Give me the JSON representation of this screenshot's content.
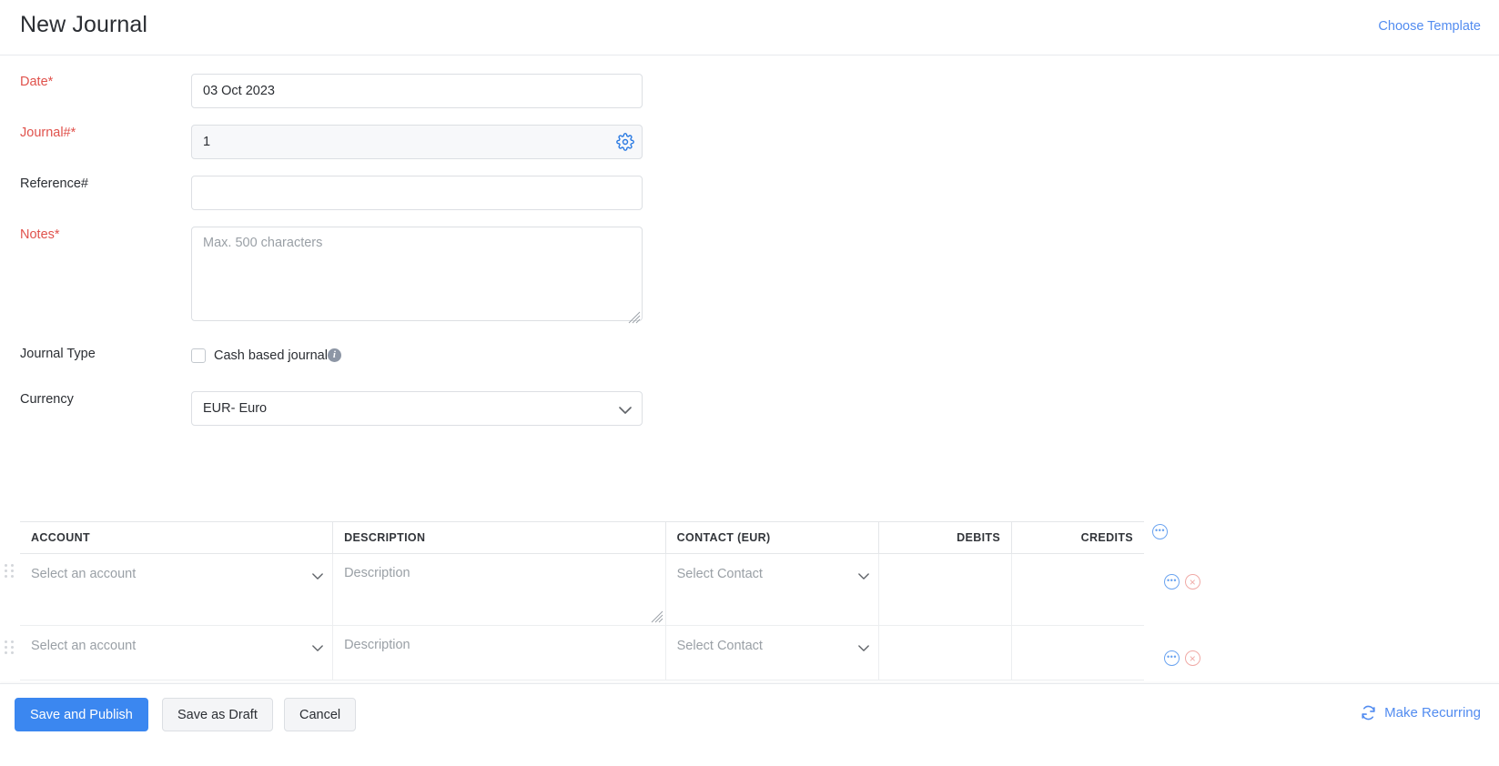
{
  "header": {
    "title": "New Journal",
    "choose_template": "Choose Template"
  },
  "form": {
    "date": {
      "label": "Date",
      "required": true,
      "value": "03 Oct 2023"
    },
    "journal_no": {
      "label": "Journal#",
      "required": true,
      "value": "1",
      "settings_icon": "gear-icon"
    },
    "reference_no": {
      "label": "Reference#",
      "required": false,
      "value": "",
      "placeholder": ""
    },
    "notes": {
      "label": "Notes",
      "required": true,
      "value": "",
      "placeholder": "Max. 500 characters"
    },
    "journal_type": {
      "label": "Journal Type",
      "checkbox_label": "Cash based journal",
      "checked": false,
      "info_icon": "info-icon",
      "info_glyph": "i"
    },
    "currency": {
      "label": "Currency",
      "value": "EUR- Euro",
      "options": [
        "EUR- Euro"
      ]
    }
  },
  "items_table": {
    "columns": [
      {
        "key": "account",
        "label": "ACCOUNT",
        "align": "left"
      },
      {
        "key": "description",
        "label": "DESCRIPTION",
        "align": "left"
      },
      {
        "key": "contact",
        "label": "CONTACT (EUR)",
        "align": "left"
      },
      {
        "key": "debits",
        "label": "DEBITS",
        "align": "right"
      },
      {
        "key": "credits",
        "label": "CREDITS",
        "align": "right"
      }
    ],
    "header_action_icon": "ellipsis-circle-icon",
    "rows": [
      {
        "account_placeholder": "Select an account",
        "description_placeholder": "Description",
        "contact_placeholder": "Select Contact",
        "debits": "",
        "credits": ""
      },
      {
        "account_placeholder": "Select an account",
        "description_placeholder": "Description",
        "contact_placeholder": "Select Contact",
        "debits": "",
        "credits": ""
      }
    ],
    "row_action_more_icon": "ellipsis-circle-icon",
    "row_action_delete_icon": "remove-circle-icon"
  },
  "footer": {
    "save_publish": "Save and Publish",
    "save_draft": "Save as Draft",
    "cancel": "Cancel",
    "make_recurring": "Make Recurring",
    "make_recurring_icon": "refresh-cycle-icon"
  },
  "colors": {
    "accent": "#3b87f0",
    "link": "#528cf0",
    "required": "#e0524c",
    "placeholder": "#9aa0a6",
    "border": "#dcdfe3"
  }
}
